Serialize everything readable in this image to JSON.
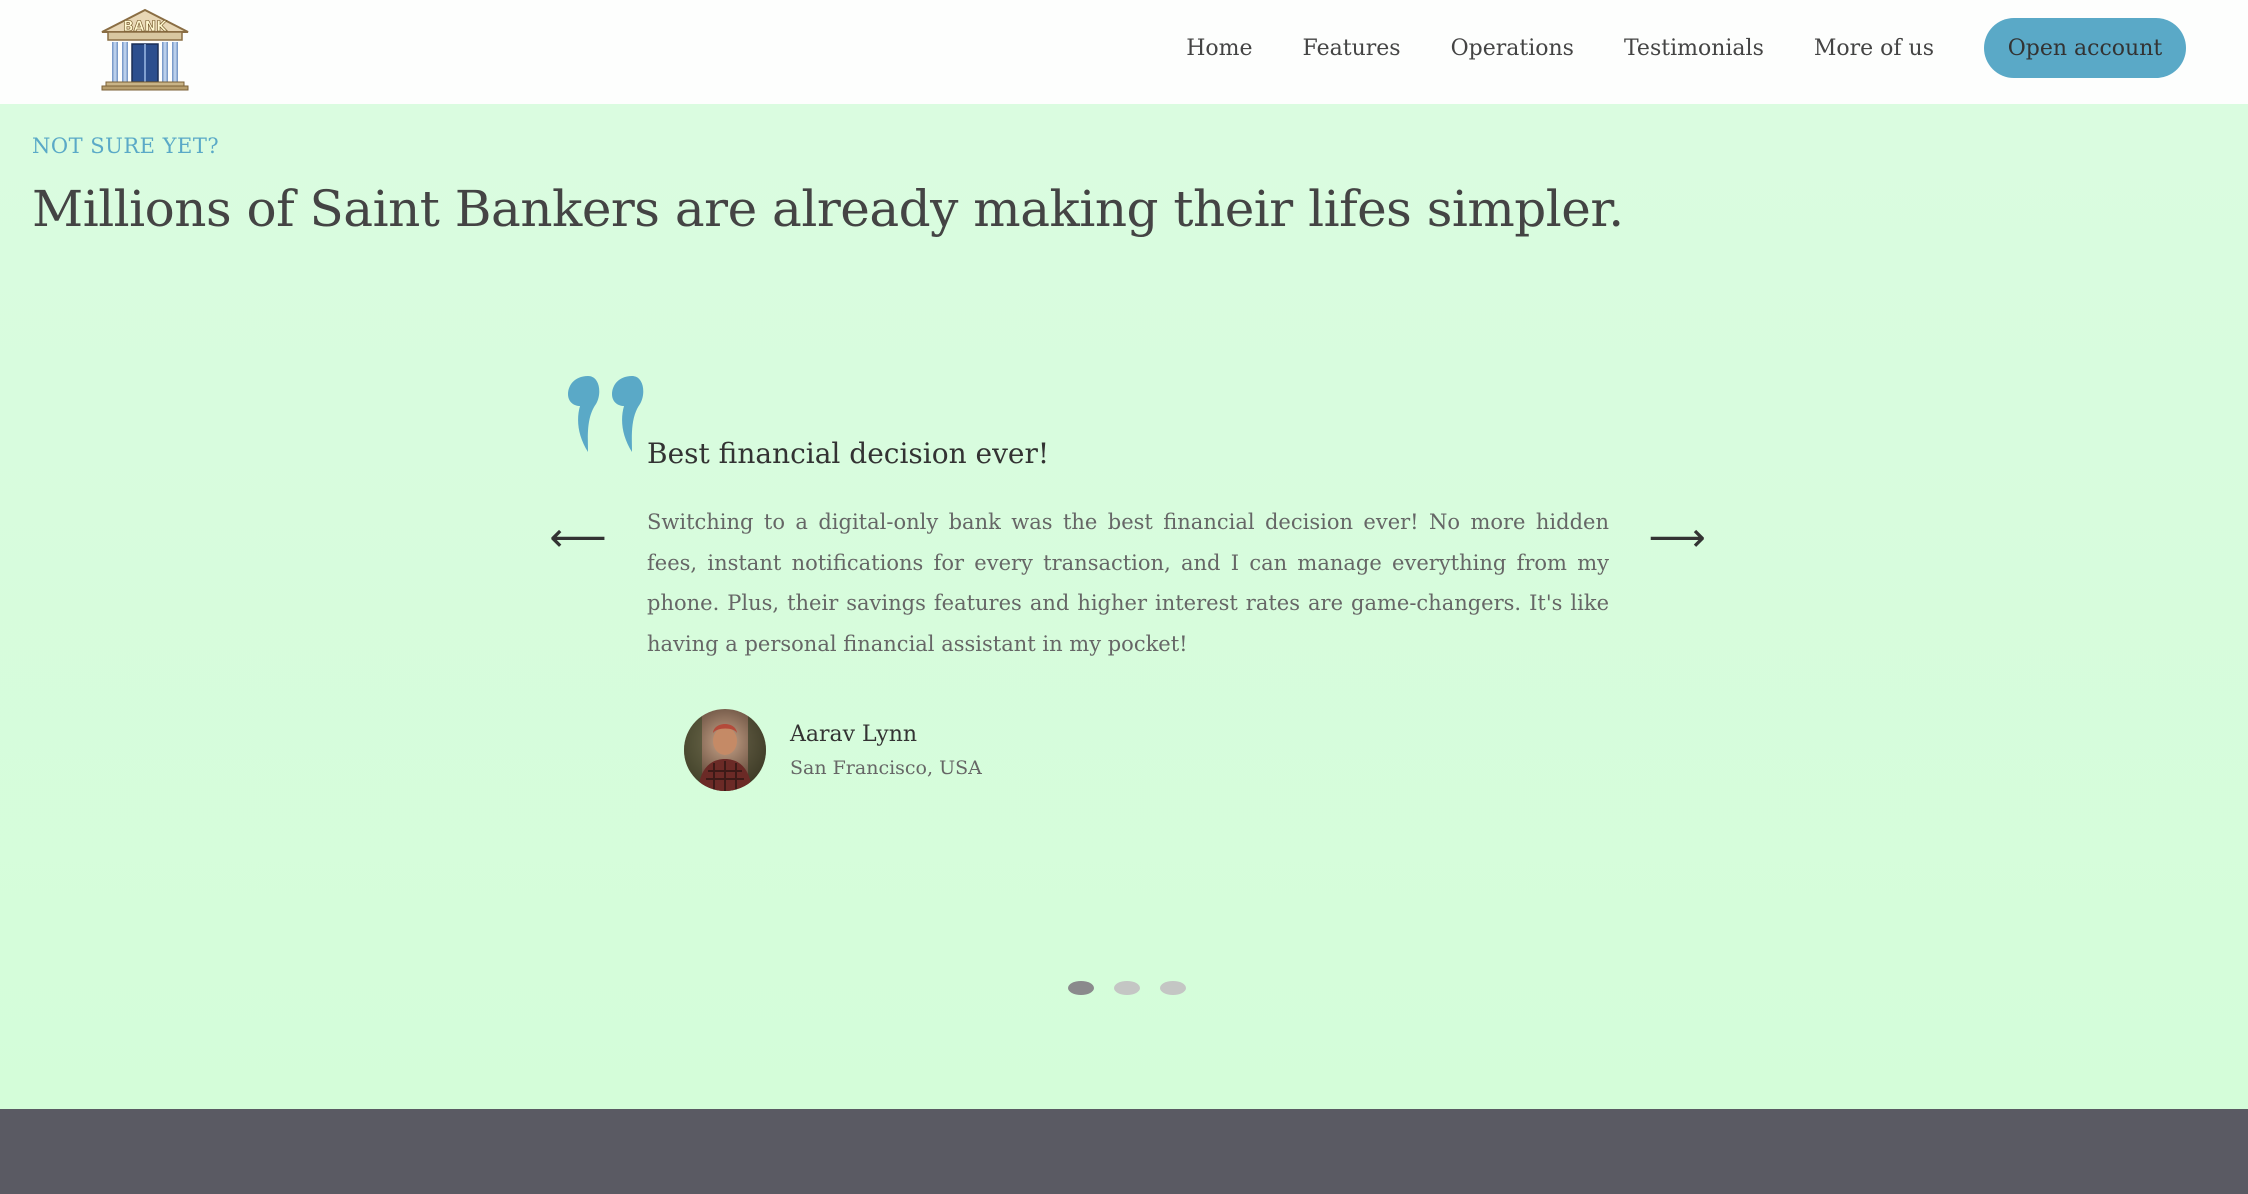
{
  "nav": {
    "logo_text": "BANK",
    "links": [
      {
        "label": "Home"
      },
      {
        "label": "Features"
      },
      {
        "label": "Operations"
      },
      {
        "label": "Testimonials"
      },
      {
        "label": "More of us"
      }
    ],
    "cta_label": "Open account"
  },
  "section": {
    "eyebrow": "NOT SURE YET?",
    "headline": "Millions of Saint Bankers are already making their lifes simpler."
  },
  "testimonial": {
    "title": "Best financial decision ever!",
    "body": "Switching to a digital-only bank was the best financial decision ever! No more hidden fees, instant notifications for every transaction, and I can manage everything from my phone. Plus, their savings features and higher interest rates are game-changers. It's like having a personal financial assistant in my pocket!",
    "author_name": "Aarav Lynn",
    "author_location": "San Francisco, USA",
    "prev_icon": "arrow-left-icon",
    "next_icon": "arrow-right-icon",
    "prev_glyph": "⟵",
    "next_glyph": "⟶"
  },
  "slider": {
    "dot_count": 3,
    "active_index": 0
  },
  "colors": {
    "accent": "#5aa9c7",
    "section_bg": "#d9fbe0",
    "footer_bg": "#5a5a63",
    "text": "#444444"
  }
}
